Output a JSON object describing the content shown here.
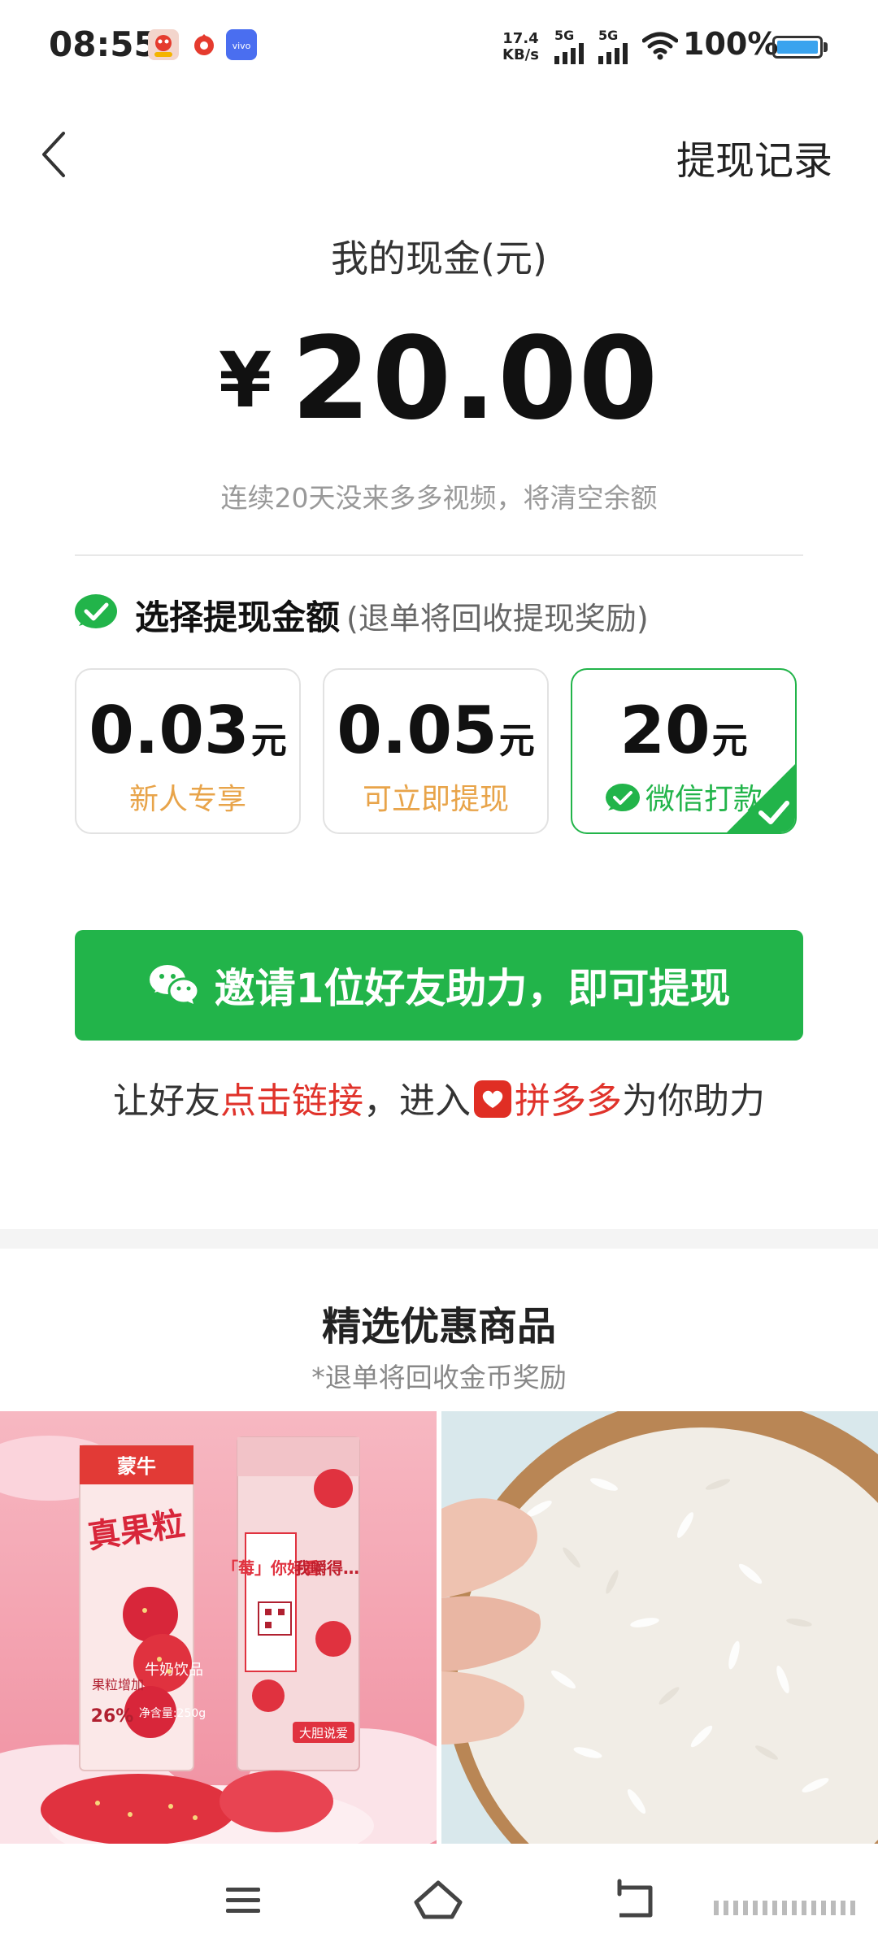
{
  "status_bar": {
    "time": "08:55",
    "net_speed_value": "17.4",
    "net_speed_unit": "KB/s",
    "signal_1": "5G",
    "signal_2": "5G",
    "battery": "100%",
    "app_icons": [
      "pinduoduo-app-icon",
      "red-app-icon",
      "vivo-icon"
    ]
  },
  "nav": {
    "back_icon": "chevron-left-icon",
    "records_label": "提现记录"
  },
  "cash": {
    "title": "我的现金(元)",
    "currency": "¥",
    "amount": "20.00",
    "warning": "连续20天没来多多视频，将清空余额"
  },
  "withdraw": {
    "title": "选择提现金额",
    "note": "(退单将回收提现奖励)",
    "options": [
      {
        "value": "0.03",
        "unit": "元",
        "tag": "新人专享",
        "selected": false
      },
      {
        "value": "0.05",
        "unit": "元",
        "tag": "可立即提现",
        "selected": false
      },
      {
        "value": "20",
        "unit": "元",
        "tag": "微信打款",
        "selected": true
      }
    ]
  },
  "invite": {
    "button_label": "邀请1位好友助力，即可提现",
    "hint_part1": "让好友",
    "hint_link": "点击链接",
    "hint_part2": "，进入",
    "hint_app": "拼多多",
    "hint_part3": "为你助力"
  },
  "products": {
    "title": "精选优惠商品",
    "note": "*退单将回收金币奖励",
    "items": [
      {
        "image": "strawberry-milk-drink-photo",
        "brand": "蒙牛",
        "product_name": "真果粒",
        "box_slogan": "「莓」你好看",
        "box_sub": "我嚼得…",
        "pack_text": "牛奶饮品",
        "fruit_text": "果粒增加",
        "percent": "26%",
        "net_weight": "净含量:250g",
        "bottom_label": "大胆说爱"
      },
      {
        "image": "white-rice-in-bowl-photo"
      }
    ]
  },
  "bottom_nav": {
    "menu_icon": "menu-icon",
    "home_icon": "home-icon",
    "back_icon": "return-icon"
  },
  "colors": {
    "accent_green": "#22b44a",
    "tag_orange": "#e8a44a",
    "highlight_red": "#e0332b"
  }
}
